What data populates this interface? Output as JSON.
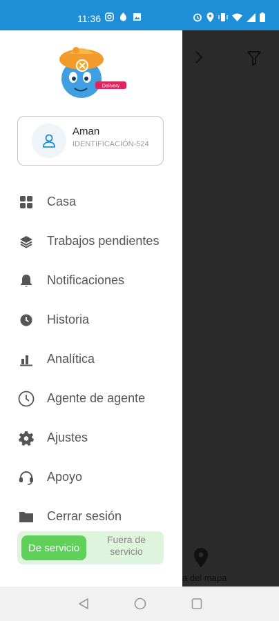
{
  "status_bar": {
    "time": "11:36",
    "icons": [
      "instagram-icon",
      "fire-icon",
      "image-icon",
      "alarm-icon",
      "location-icon",
      "vibrate-icon",
      "wifi-icon",
      "signal-icon",
      "battery-icon"
    ],
    "color": "#1e8fd6"
  },
  "logo": {
    "badge_text": "Delivery"
  },
  "user": {
    "name": "Aman",
    "id_text": "IDENTIFICACIÓN-524"
  },
  "menu": {
    "items": [
      {
        "label": "Casa",
        "icon": "grid-icon"
      },
      {
        "label": "Trabajos pendientes",
        "icon": "layers-icon"
      },
      {
        "label": "Notificaciones",
        "icon": "bell-icon"
      },
      {
        "label": "Historia",
        "icon": "clock-icon"
      },
      {
        "label": "Analítica",
        "icon": "bar-chart-icon"
      },
      {
        "label": "Agente de agente",
        "icon": "clock-outline-icon"
      },
      {
        "label": "Ajustes",
        "icon": "gear-icon"
      },
      {
        "label": "Apoyo",
        "icon": "headset-icon"
      },
      {
        "label": "Cerrar sesión",
        "icon": "folder-icon"
      }
    ]
  },
  "duty_toggle": {
    "on_label": "De servicio",
    "off_label": "Fuera de servicio",
    "active": "on"
  },
  "backdrop": {
    "map_label": "a del mapa"
  },
  "colors": {
    "accent_green": "#5fd15a",
    "toggle_bg": "#dff4dc",
    "overlay": "#2b2b2b"
  }
}
